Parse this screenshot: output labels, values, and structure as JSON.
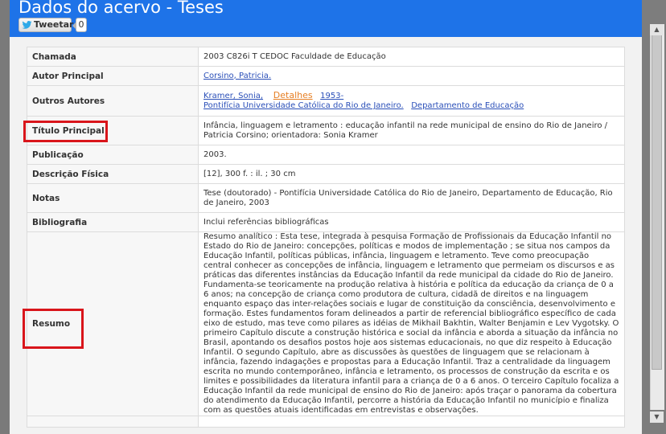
{
  "modal": {
    "title": "Dados do acervo - Teses",
    "tweet_label": "Tweetar",
    "tweet_count": "0"
  },
  "record": {
    "chamada": {
      "label": "Chamada",
      "value": "2003   C826i   T   CEDOC   Faculdade de Educação"
    },
    "autor": {
      "label": "Autor Principal",
      "value": "Corsino, Patricia."
    },
    "outros": {
      "label": "Outros Autores",
      "author": "Kramer, Sonia,",
      "detalhes": "Detalhes",
      "year": "1953-",
      "inst1": "Pontifícia Universidade Católica do Rio de Janeiro.",
      "inst2": "Departamento de Educação"
    },
    "titulo": {
      "label": "Título Principal",
      "value": "Infância, linguagem e letramento :    educação infantil na rede municipal de ensino do Rio de Janeiro  /    Patricia Corsino; orientadora: Sonia Kramer"
    },
    "publicacao": {
      "label": "Publicação",
      "value": "2003."
    },
    "descricao": {
      "label": "Descrição Física",
      "value": "[12], 300 f. :    il. ;    30 cm"
    },
    "notas": {
      "label": "Notas",
      "value": "Tese (doutorado) - Pontifícia Universidade Católica do Rio de Janeiro, Departamento de Educação, Rio de Janeiro, 2003"
    },
    "bibliografia": {
      "label": "Bibliografia",
      "value": "Inclui referências bibliográficas"
    },
    "resumo": {
      "label": "Resumo",
      "value": "Resumo analítico : Esta tese, integrada à pesquisa Formação de Profissionais da Educação Infantil no Estado do Rio de Janeiro: concepções, políticas e modos de implementação ; se situa nos campos da Educação Infantil, políticas públicas, infância, linguagem e letramento. Teve como preocupação central conhecer as concepções de infância, linguagem e letramento que permeiam os discursos e as práticas das diferentes instâncias da Educação Infantil da rede municipal da cidade do Rio de Janeiro. Fundamenta-se teoricamente na produção relativa à história e política da educação da criança de 0 a 6 anos; na concepção de criança como produtora de cultura, cidadã de direitos e na linguagem enquanto espaço das inter-relações sociais e lugar de constituição da consciência, desenvolvimento e formação. Estes fundamentos foram delineados a partir de referencial bibliográfico específico de cada eixo de estudo, mas teve como pilares as idéias de Mikhail Bakhtin, Walter Benjamin e Lev Vygotsky. O primeiro Capítulo discute a construção histórica e social da infância e aborda a situação da infância no Brasil, apontando os desafios postos hoje aos sistemas educacionais, no que diz respeito à Educação Infantil. O segundo Capítulo, abre as discussões às questões de linguagem que se relacionam à infância, fazendo indagações e propostas para a Educação Infantil. Traz a centralidade da linguagem escrita no mundo contemporâneo, infância e letramento, os processos de construção da escrita e os limites e possibilidades da literatura infantil para a criança de 0 a 6 anos. O terceiro Capítulo focaliza a Educação Infantil da rede municipal de ensino do Rio de Janeiro: após traçar o panorama da cobertura do atendimento da Educação Infantil, percorre a história da Educação Infantil no município e finaliza com as questões atuais identificadas em entrevistas e observações."
    }
  },
  "colors": {
    "header_bg": "#1e73e8",
    "highlight": "#d9151b",
    "link": "#2a4fb8",
    "link_orange": "#e67e22"
  }
}
